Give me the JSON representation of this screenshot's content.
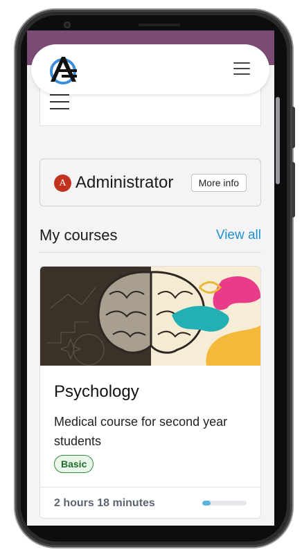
{
  "header": {
    "logo": "AE-logo"
  },
  "user": {
    "avatar_initial": "A",
    "name": "Administrator",
    "more_info_label": "More info"
  },
  "courses_section": {
    "title": "My courses",
    "view_all_label": "View all"
  },
  "course": {
    "title": "Psychology",
    "description": "Medical course for second year students",
    "badge": "Basic",
    "duration": "2 hours 18 minutes",
    "progress": 0.18
  },
  "colors": {
    "topbar": "#7b4b73",
    "accent_link": "#1e8fcf",
    "badge_green": "#2f8a3b",
    "avatar_red": "#c2331f",
    "progress": "#5bb3e0"
  }
}
